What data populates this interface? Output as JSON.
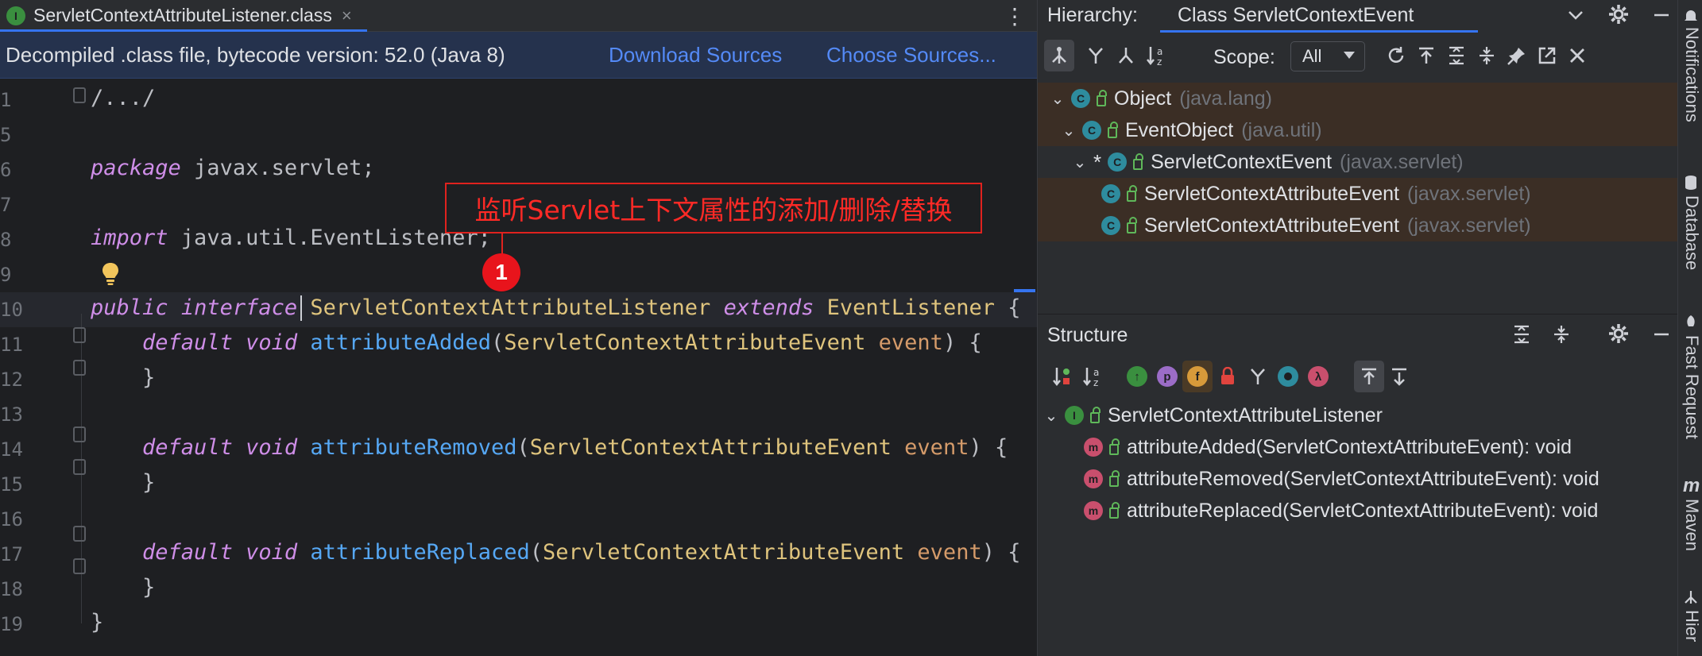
{
  "editor": {
    "tab": {
      "icon": "interface-icon",
      "icon_letter": "I",
      "label": "ServletContextAttributeListener.class",
      "close": "×"
    },
    "more": "⋮",
    "infobar": {
      "text": "Decompiled .class file, bytecode version: 52.0 (Java 8)",
      "download": "Download Sources",
      "choose": "Choose Sources..."
    },
    "lines": [
      {
        "num": "1",
        "segments": [
          {
            "t": "/.../",
            "c": "plain"
          }
        ]
      },
      {
        "num": "5",
        "segments": []
      },
      {
        "num": "6",
        "segments": [
          {
            "t": "package",
            "c": "kw"
          },
          {
            "t": " javax.servlet;",
            "c": "plain"
          }
        ]
      },
      {
        "num": "7",
        "segments": []
      },
      {
        "num": "8",
        "segments": [
          {
            "t": "import",
            "c": "kw"
          },
          {
            "t": " java.util.EventListener;",
            "c": "plain"
          }
        ]
      },
      {
        "num": "9",
        "segments": []
      },
      {
        "num": "10",
        "segments": [
          {
            "t": "public",
            "c": "kw"
          },
          {
            "t": " ",
            "c": "plain"
          },
          {
            "t": "interface",
            "c": "kw"
          },
          {
            "t": " ",
            "c": "plain"
          },
          {
            "t": "ServletContextAttributeListener",
            "c": "type"
          },
          {
            "t": " ",
            "c": "plain"
          },
          {
            "t": "extends",
            "c": "kw"
          },
          {
            "t": " ",
            "c": "plain"
          },
          {
            "t": "EventListener",
            "c": "type"
          },
          {
            "t": " {",
            "c": "plain"
          }
        ]
      },
      {
        "num": "11",
        "segments": [
          {
            "t": "    ",
            "c": "plain"
          },
          {
            "t": "default",
            "c": "kw"
          },
          {
            "t": " ",
            "c": "plain"
          },
          {
            "t": "void",
            "c": "kw"
          },
          {
            "t": " ",
            "c": "plain"
          },
          {
            "t": "attributeAdded",
            "c": "fn"
          },
          {
            "t": "(",
            "c": "plain"
          },
          {
            "t": "ServletContextAttributeEvent",
            "c": "type"
          },
          {
            "t": " ",
            "c": "plain"
          },
          {
            "t": "event",
            "c": "param"
          },
          {
            "t": ") {",
            "c": "plain"
          }
        ]
      },
      {
        "num": "12",
        "segments": [
          {
            "t": "    }",
            "c": "plain"
          }
        ]
      },
      {
        "num": "13",
        "segments": []
      },
      {
        "num": "14",
        "segments": [
          {
            "t": "    ",
            "c": "plain"
          },
          {
            "t": "default",
            "c": "kw"
          },
          {
            "t": " ",
            "c": "plain"
          },
          {
            "t": "void",
            "c": "kw"
          },
          {
            "t": " ",
            "c": "plain"
          },
          {
            "t": "attributeRemoved",
            "c": "fn"
          },
          {
            "t": "(",
            "c": "plain"
          },
          {
            "t": "ServletContextAttributeEvent",
            "c": "type"
          },
          {
            "t": " ",
            "c": "plain"
          },
          {
            "t": "event",
            "c": "param"
          },
          {
            "t": ") {",
            "c": "plain"
          }
        ]
      },
      {
        "num": "15",
        "segments": [
          {
            "t": "    }",
            "c": "plain"
          }
        ]
      },
      {
        "num": "16",
        "segments": []
      },
      {
        "num": "17",
        "segments": [
          {
            "t": "    ",
            "c": "plain"
          },
          {
            "t": "default",
            "c": "kw"
          },
          {
            "t": " ",
            "c": "plain"
          },
          {
            "t": "void",
            "c": "kw"
          },
          {
            "t": " ",
            "c": "plain"
          },
          {
            "t": "attributeReplaced",
            "c": "fn"
          },
          {
            "t": "(",
            "c": "plain"
          },
          {
            "t": "ServletContextAttributeEvent",
            "c": "type"
          },
          {
            "t": " ",
            "c": "plain"
          },
          {
            "t": "event",
            "c": "param"
          },
          {
            "t": ") {",
            "c": "plain"
          }
        ]
      },
      {
        "num": "18",
        "segments": [
          {
            "t": "    }",
            "c": "plain"
          }
        ]
      },
      {
        "num": "19",
        "segments": [
          {
            "t": "}",
            "c": "plain"
          }
        ]
      }
    ],
    "annotation": {
      "text": "监听Servlet上下文属性的添加/删除/替换",
      "badge": "1"
    }
  },
  "hierarchy": {
    "title": "Hierarchy:",
    "tab": "Class ServletContextEvent",
    "scope_label": "Scope:",
    "scope_value": "All",
    "tree": [
      {
        "name": "Object",
        "pkg": "(java.lang)",
        "icon": "class-icon",
        "expanded": true,
        "marker": ""
      },
      {
        "name": "EventObject",
        "pkg": "(java.util)",
        "icon": "class-icon",
        "expanded": true,
        "marker": ""
      },
      {
        "name": "ServletContextEvent",
        "pkg": "(javax.servlet)",
        "icon": "class-icon",
        "expanded": true,
        "marker": "*"
      },
      {
        "name": "ServletContextAttributeEvent",
        "pkg": "(javax.servlet)",
        "icon": "class-icon",
        "expanded": false,
        "marker": ""
      },
      {
        "name": "ServletContextAttributeEvent",
        "pkg": "(javax.servlet)",
        "icon": "class-icon",
        "expanded": false,
        "marker": ""
      }
    ]
  },
  "structure": {
    "title": "Structure",
    "root": {
      "name": "ServletContextAttributeListener",
      "icon": "interface-icon",
      "letter": "I"
    },
    "members": [
      {
        "label": "attributeAdded(ServletContextAttributeEvent): void",
        "icon": "method-icon",
        "letter": "m"
      },
      {
        "label": "attributeRemoved(ServletContextAttributeEvent): void",
        "icon": "method-icon",
        "letter": "m"
      },
      {
        "label": "attributeReplaced(ServletContextAttributeEvent): void",
        "icon": "method-icon",
        "letter": "m"
      }
    ],
    "filter_letters": {
      "p": "p",
      "f": "f",
      "lambda": "λ"
    }
  },
  "strip": {
    "labels": [
      "Notifications",
      "Database",
      "Fast Request",
      "Maven",
      "Hier"
    ],
    "maven_letter": "m"
  },
  "colors": {
    "accent": "#3574f0",
    "link": "#548af7",
    "keyword": "#cf8ee8",
    "type": "#dfc47d",
    "function": "#56a8f5",
    "annotation": "#e0221e",
    "hierarchy_highlight": "#3b2e25"
  }
}
